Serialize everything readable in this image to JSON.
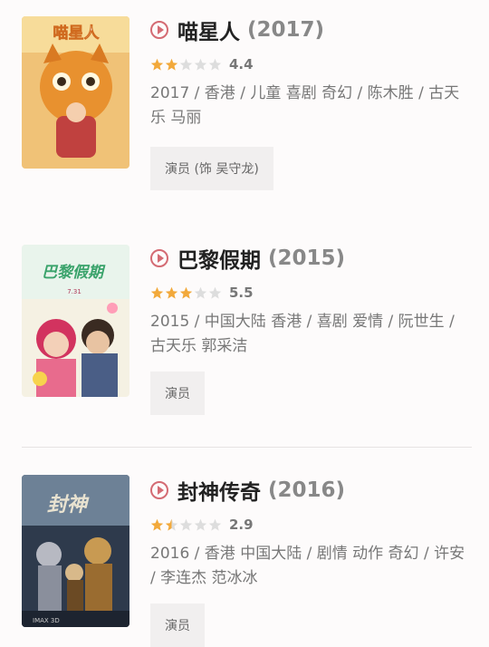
{
  "movies": [
    {
      "title": "喵星人",
      "year": "(2017)",
      "rating": 4.4,
      "rating_text": "4.4",
      "stars_filled": 2,
      "meta": "2017 / 香港 / 儿童 喜剧 奇幻 / 陈木胜 / 古天乐 马丽",
      "role": "演员 (饰 吴守龙)",
      "poster_colors": {
        "bg": "#e9b25c",
        "accent": "#e87b2a"
      }
    },
    {
      "title": "巴黎假期",
      "year": "(2015)",
      "rating": 5.5,
      "rating_text": "5.5",
      "stars_filled": 3,
      "meta": "2015 / 中国大陆 香港 / 喜剧 爱情 / 阮世生 / 古天乐 郭采洁",
      "role": "演员",
      "poster_colors": {
        "bg": "#f3f0e6",
        "accent": "#d23c73"
      }
    },
    {
      "title": "封神传奇",
      "year": "(2016)",
      "rating": 2.9,
      "rating_text": "2.9",
      "stars_filled": 1.5,
      "meta": "2016 / 香港 中国大陆 / 剧情 动作 奇幻 / 许安 / 李连杰 范冰冰",
      "role": "演员",
      "poster_colors": {
        "bg": "#3b4b5e",
        "accent": "#b88a45"
      }
    }
  ],
  "colors": {
    "star_on": "#f2a93b",
    "star_off": "#dddddd",
    "play": "#d46b73"
  },
  "icons": {
    "play": "play-circle-icon",
    "star": "star-icon"
  }
}
